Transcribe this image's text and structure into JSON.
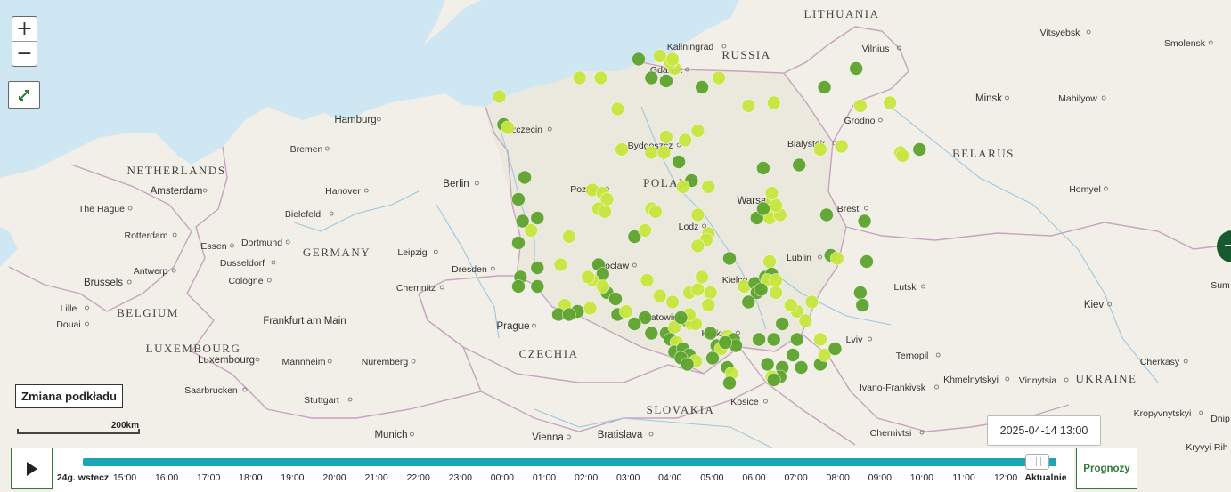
{
  "map": {
    "countries": [
      {
        "id": "lithuania",
        "label": "LITHUANIA"
      },
      {
        "id": "russia",
        "label": "RUSSIA"
      },
      {
        "id": "netherlands",
        "label": "NETHERLANDS"
      },
      {
        "id": "germany",
        "label": "GERMANY"
      },
      {
        "id": "belgium",
        "label": "BELGIUM"
      },
      {
        "id": "luxembourg",
        "label": "LUXEMBOURG"
      },
      {
        "id": "poland",
        "label": "POLAND"
      },
      {
        "id": "belarus",
        "label": "BELARUS"
      },
      {
        "id": "czechia",
        "label": "CZECHIA"
      },
      {
        "id": "slovakia",
        "label": "SLOVAKIA"
      },
      {
        "id": "ukraine",
        "label": "UKRAINE"
      }
    ],
    "cities": [
      "Vilnius",
      "Kaliningrad",
      "Gdansk",
      "Vitsyebsk",
      "Smolensk",
      "Minsk",
      "Mahilyow",
      "Grodno",
      "Hamburg",
      "Szczecin",
      "Bremen",
      "Bydgoszcz",
      "Bialystok",
      "Amsterdam",
      "The Hague",
      "Rotterdam",
      "Berlin",
      "Hanover",
      "Poznan",
      "Warsaw",
      "Homyel",
      "Bielefeld",
      "Brest",
      "Lodz",
      "Essen",
      "Dortmund",
      "Dusseldorf",
      "Leipzig",
      "Antwerp",
      "Brussels",
      "Cologne",
      "Dresden",
      "Wroclaw",
      "Lublin",
      "Chemnitz",
      "Kielce",
      "Lutsk",
      "Lille",
      "Douai",
      "Frankfurt am Main",
      "Prague",
      "Katowice",
      "Krakow",
      "Lviv",
      "Kiev",
      "Luxembourg",
      "Mannheim",
      "Nuremberg",
      "Ternopil",
      "Cherkasy",
      "Khmelnytskyi",
      "Vinnytsia",
      "Ivano-Frankivsk",
      "Saarbrucken",
      "Stuttgart",
      "Kosice",
      "Kropyvnytskyi",
      "Dnip",
      "Munich",
      "Vienna",
      "Bratislava",
      "Chernivtsi",
      "Kryvyi Rih",
      "Sum"
    ],
    "station_colors": {
      "dark": "#5ea42e",
      "mid": "#86c23a",
      "light": "#c8e63f"
    },
    "stations": [
      {
        "lon": 18.65,
        "lat": 54.35,
        "c": "light"
      },
      {
        "lon": 18.55,
        "lat": 54.45,
        "c": "light"
      },
      {
        "lon": 18.3,
        "lat": 54.55,
        "c": "light"
      },
      {
        "lon": 18.6,
        "lat": 54.5,
        "c": "light"
      },
      {
        "lon": 17.8,
        "lat": 54.5,
        "c": "dark"
      },
      {
        "lon": 16.4,
        "lat": 54.2,
        "c": "light"
      },
      {
        "lon": 16.9,
        "lat": 54.2,
        "c": "light"
      },
      {
        "lon": 18.1,
        "lat": 54.2,
        "c": "dark"
      },
      {
        "lon": 18.45,
        "lat": 54.15,
        "c": "dark"
      },
      {
        "lon": 19.3,
        "lat": 54.05,
        "c": "dark"
      },
      {
        "lon": 19.7,
        "lat": 54.2,
        "c": "light"
      },
      {
        "lon": 14.5,
        "lat": 53.9,
        "c": "light"
      },
      {
        "lon": 14.6,
        "lat": 53.45,
        "c": "dark"
      },
      {
        "lon": 14.7,
        "lat": 53.4,
        "c": "light"
      },
      {
        "lon": 17.3,
        "lat": 53.7,
        "c": "light"
      },
      {
        "lon": 19.2,
        "lat": 53.35,
        "c": "light"
      },
      {
        "lon": 20.4,
        "lat": 53.75,
        "c": "light"
      },
      {
        "lon": 21.0,
        "lat": 53.8,
        "c": "light"
      },
      {
        "lon": 22.2,
        "lat": 54.05,
        "c": "dark"
      },
      {
        "lon": 22.95,
        "lat": 54.35,
        "c": "dark"
      },
      {
        "lon": 23.05,
        "lat": 53.75,
        "c": "light"
      },
      {
        "lon": 23.75,
        "lat": 53.8,
        "c": "light"
      },
      {
        "lon": 17.4,
        "lat": 53.05,
        "c": "light"
      },
      {
        "lon": 18.1,
        "lat": 53.0,
        "c": "light"
      },
      {
        "lon": 18.4,
        "lat": 53.0,
        "c": "light"
      },
      {
        "lon": 18.45,
        "lat": 53.25,
        "c": "light"
      },
      {
        "lon": 18.9,
        "lat": 53.2,
        "c": "light"
      },
      {
        "lon": 18.75,
        "lat": 52.85,
        "c": "dark"
      },
      {
        "lon": 22.1,
        "lat": 53.05,
        "c": "light"
      },
      {
        "lon": 22.6,
        "lat": 53.1,
        "c": "light"
      },
      {
        "lon": 21.6,
        "lat": 52.8,
        "c": "dark"
      },
      {
        "lon": 20.75,
        "lat": 52.75,
        "c": "dark"
      },
      {
        "lon": 24.0,
        "lat": 53.0,
        "c": "light"
      },
      {
        "lon": 24.05,
        "lat": 52.95,
        "c": "light"
      },
      {
        "lon": 24.45,
        "lat": 53.05,
        "c": "dark"
      },
      {
        "lon": 15.1,
        "lat": 52.6,
        "c": "dark"
      },
      {
        "lon": 14.95,
        "lat": 52.25,
        "c": "dark"
      },
      {
        "lon": 16.7,
        "lat": 52.4,
        "c": "light"
      },
      {
        "lon": 16.95,
        "lat": 52.35,
        "c": "light"
      },
      {
        "lon": 17.05,
        "lat": 52.25,
        "c": "light"
      },
      {
        "lon": 16.85,
        "lat": 52.1,
        "c": "light"
      },
      {
        "lon": 17.0,
        "lat": 52.05,
        "c": "light"
      },
      {
        "lon": 18.1,
        "lat": 52.1,
        "c": "light"
      },
      {
        "lon": 18.2,
        "lat": 52.05,
        "c": "light"
      },
      {
        "lon": 19.05,
        "lat": 52.55,
        "c": "dark"
      },
      {
        "lon": 19.45,
        "lat": 52.45,
        "c": "light"
      },
      {
        "lon": 18.85,
        "lat": 52.45,
        "c": "light"
      },
      {
        "lon": 19.2,
        "lat": 52.0,
        "c": "light"
      },
      {
        "lon": 20.95,
        "lat": 52.2,
        "c": "light"
      },
      {
        "lon": 20.85,
        "lat": 52.05,
        "c": "light"
      },
      {
        "lon": 20.9,
        "lat": 51.95,
        "c": "light"
      },
      {
        "lon": 21.15,
        "lat": 52.0,
        "c": "light"
      },
      {
        "lon": 21.05,
        "lat": 52.15,
        "c": "light"
      },
      {
        "lon": 20.6,
        "lat": 51.95,
        "c": "dark"
      },
      {
        "lon": 20.95,
        "lat": 52.35,
        "c": "light"
      },
      {
        "lon": 20.75,
        "lat": 52.1,
        "c": "dark"
      },
      {
        "lon": 22.25,
        "lat": 52.0,
        "c": "dark"
      },
      {
        "lon": 23.15,
        "lat": 51.9,
        "c": "dark"
      },
      {
        "lon": 15.4,
        "lat": 51.95,
        "c": "dark"
      },
      {
        "lon": 15.25,
        "lat": 51.75,
        "c": "light"
      },
      {
        "lon": 15.05,
        "lat": 51.9,
        "c": "dark"
      },
      {
        "lon": 16.15,
        "lat": 51.65,
        "c": "light"
      },
      {
        "lon": 14.95,
        "lat": 51.55,
        "c": "dark"
      },
      {
        "lon": 17.7,
        "lat": 51.65,
        "c": "dark"
      },
      {
        "lon": 17.95,
        "lat": 51.75,
        "c": "light"
      },
      {
        "lon": 19.45,
        "lat": 51.7,
        "c": "light"
      },
      {
        "lon": 19.4,
        "lat": 51.6,
        "c": "light"
      },
      {
        "lon": 19.2,
        "lat": 51.5,
        "c": "light"
      },
      {
        "lon": 19.95,
        "lat": 51.3,
        "c": "dark"
      },
      {
        "lon": 20.9,
        "lat": 51.25,
        "c": "light"
      },
      {
        "lon": 15.4,
        "lat": 51.15,
        "c": "dark"
      },
      {
        "lon": 15.95,
        "lat": 51.2,
        "c": "light"
      },
      {
        "lon": 16.85,
        "lat": 51.2,
        "c": "dark"
      },
      {
        "lon": 16.95,
        "lat": 51.05,
        "c": "dark"
      },
      {
        "lon": 16.7,
        "lat": 50.95,
        "c": "light"
      },
      {
        "lon": 16.6,
        "lat": 51.0,
        "c": "light"
      },
      {
        "lon": 15.0,
        "lat": 51.0,
        "c": "dark"
      },
      {
        "lon": 14.95,
        "lat": 50.85,
        "c": "dark"
      },
      {
        "lon": 15.4,
        "lat": 50.85,
        "c": "dark"
      },
      {
        "lon": 17.05,
        "lat": 50.75,
        "c": "dark"
      },
      {
        "lon": 17.25,
        "lat": 50.65,
        "c": "dark"
      },
      {
        "lon": 16.95,
        "lat": 50.85,
        "c": "light"
      },
      {
        "lon": 18.0,
        "lat": 50.95,
        "c": "light"
      },
      {
        "lon": 18.3,
        "lat": 50.7,
        "c": "light"
      },
      {
        "lon": 18.6,
        "lat": 50.6,
        "c": "light"
      },
      {
        "lon": 19.0,
        "lat": 50.75,
        "c": "light"
      },
      {
        "lon": 19.2,
        "lat": 50.8,
        "c": "light"
      },
      {
        "lon": 19.5,
        "lat": 50.75,
        "c": "light"
      },
      {
        "lon": 19.45,
        "lat": 50.55,
        "c": "light"
      },
      {
        "lon": 19.3,
        "lat": 51.0,
        "c": "light"
      },
      {
        "lon": 20.3,
        "lat": 50.85,
        "c": "light"
      },
      {
        "lon": 20.55,
        "lat": 50.9,
        "c": "dark"
      },
      {
        "lon": 20.6,
        "lat": 50.75,
        "c": "dark"
      },
      {
        "lon": 20.8,
        "lat": 51.0,
        "c": "dark"
      },
      {
        "lon": 20.95,
        "lat": 51.05,
        "c": "dark"
      },
      {
        "lon": 20.85,
        "lat": 50.95,
        "c": "light"
      },
      {
        "lon": 21.05,
        "lat": 50.95,
        "c": "light"
      },
      {
        "lon": 20.7,
        "lat": 50.8,
        "c": "dark"
      },
      {
        "lon": 20.4,
        "lat": 50.6,
        "c": "dark"
      },
      {
        "lon": 21.05,
        "lat": 50.75,
        "c": "light"
      },
      {
        "lon": 22.35,
        "lat": 51.35,
        "c": "dark"
      },
      {
        "lon": 22.5,
        "lat": 51.3,
        "c": "light"
      },
      {
        "lon": 23.2,
        "lat": 51.25,
        "c": "dark"
      },
      {
        "lon": 23.05,
        "lat": 50.75,
        "c": "dark"
      },
      {
        "lon": 23.1,
        "lat": 50.55,
        "c": "dark"
      },
      {
        "lon": 16.65,
        "lat": 50.5,
        "c": "light"
      },
      {
        "lon": 16.35,
        "lat": 50.45,
        "c": "dark"
      },
      {
        "lon": 16.05,
        "lat": 50.55,
        "c": "light"
      },
      {
        "lon": 15.9,
        "lat": 50.4,
        "c": "dark"
      },
      {
        "lon": 16.15,
        "lat": 50.4,
        "c": "dark"
      },
      {
        "lon": 17.3,
        "lat": 50.4,
        "c": "dark"
      },
      {
        "lon": 17.5,
        "lat": 50.45,
        "c": "light"
      },
      {
        "lon": 17.95,
        "lat": 50.35,
        "c": "dark"
      },
      {
        "lon": 17.7,
        "lat": 50.25,
        "c": "dark"
      },
      {
        "lon": 18.1,
        "lat": 50.1,
        "c": "dark"
      },
      {
        "lon": 18.45,
        "lat": 50.1,
        "c": "dark"
      },
      {
        "lon": 18.65,
        "lat": 50.2,
        "c": "light"
      },
      {
        "lon": 18.95,
        "lat": 50.3,
        "c": "dark"
      },
      {
        "lon": 19.05,
        "lat": 50.25,
        "c": "light"
      },
      {
        "lon": 19.15,
        "lat": 50.25,
        "c": "light"
      },
      {
        "lon": 19.0,
        "lat": 50.4,
        "c": "light"
      },
      {
        "lon": 18.8,
        "lat": 50.35,
        "c": "dark"
      },
      {
        "lon": 18.55,
        "lat": 50.0,
        "c": "dark"
      },
      {
        "lon": 18.7,
        "lat": 49.95,
        "c": "light"
      },
      {
        "lon": 18.65,
        "lat": 49.8,
        "c": "dark"
      },
      {
        "lon": 18.85,
        "lat": 49.85,
        "c": "dark"
      },
      {
        "lon": 19.0,
        "lat": 49.75,
        "c": "dark"
      },
      {
        "lon": 18.8,
        "lat": 49.7,
        "c": "dark"
      },
      {
        "lon": 19.15,
        "lat": 49.65,
        "c": "light"
      },
      {
        "lon": 18.95,
        "lat": 49.6,
        "c": "dark"
      },
      {
        "lon": 19.5,
        "lat": 50.1,
        "c": "dark"
      },
      {
        "lon": 19.65,
        "lat": 49.9,
        "c": "dark"
      },
      {
        "lon": 19.75,
        "lat": 49.85,
        "c": "light"
      },
      {
        "lon": 19.9,
        "lat": 50.05,
        "c": "light"
      },
      {
        "lon": 19.95,
        "lat": 50.0,
        "c": "light"
      },
      {
        "lon": 20.05,
        "lat": 50.0,
        "c": "dark"
      },
      {
        "lon": 20.1,
        "lat": 49.9,
        "c": "dark"
      },
      {
        "lon": 19.85,
        "lat": 49.95,
        "c": "dark"
      },
      {
        "lon": 19.55,
        "lat": 49.7,
        "c": "dark"
      },
      {
        "lon": 19.9,
        "lat": 49.55,
        "c": "dark"
      },
      {
        "lon": 20.0,
        "lat": 49.45,
        "c": "light"
      },
      {
        "lon": 19.95,
        "lat": 49.3,
        "c": "dark"
      },
      {
        "lon": 20.65,
        "lat": 50.0,
        "c": "dark"
      },
      {
        "lon": 21.0,
        "lat": 50.0,
        "c": "dark"
      },
      {
        "lon": 21.55,
        "lat": 50.0,
        "c": "dark"
      },
      {
        "lon": 22.1,
        "lat": 50.0,
        "c": "light"
      },
      {
        "lon": 21.2,
        "lat": 50.25,
        "c": "dark"
      },
      {
        "lon": 21.55,
        "lat": 50.45,
        "c": "light"
      },
      {
        "lon": 21.75,
        "lat": 50.3,
        "c": "light"
      },
      {
        "lon": 21.4,
        "lat": 50.55,
        "c": "light"
      },
      {
        "lon": 21.9,
        "lat": 50.6,
        "c": "light"
      },
      {
        "lon": 20.85,
        "lat": 49.6,
        "c": "dark"
      },
      {
        "lon": 21.2,
        "lat": 49.55,
        "c": "dark"
      },
      {
        "lon": 21.45,
        "lat": 49.75,
        "c": "dark"
      },
      {
        "lon": 21.65,
        "lat": 49.55,
        "c": "dark"
      },
      {
        "lon": 21.15,
        "lat": 49.4,
        "c": "dark"
      },
      {
        "lon": 20.95,
        "lat": 49.4,
        "c": "light"
      },
      {
        "lon": 21.0,
        "lat": 49.35,
        "c": "dark"
      },
      {
        "lon": 22.1,
        "lat": 49.6,
        "c": "dark"
      },
      {
        "lon": 22.2,
        "lat": 49.75,
        "c": "light"
      },
      {
        "lon": 22.45,
        "lat": 49.85,
        "c": "dark"
      }
    ]
  },
  "controls": {
    "zoom_in": "+",
    "zoom_out": "−",
    "basemap_button": "Zmiana podkładu",
    "scale_label": "200km",
    "current_time": "2025-04-14 13:00",
    "forecast_button": "Prognozy"
  },
  "timeline": {
    "start_label": "24g. wstecz",
    "end_label": "Aktualnie",
    "ticks": [
      "15:00",
      "16:00",
      "17:00",
      "18:00",
      "19:00",
      "20:00",
      "21:00",
      "22:00",
      "23:00",
      "00:00",
      "01:00",
      "02:00",
      "03:00",
      "04:00",
      "05:00",
      "06:00",
      "07:00",
      "08:00",
      "09:00",
      "10:00",
      "11:00",
      "12:00"
    ],
    "progress": 0.98
  }
}
